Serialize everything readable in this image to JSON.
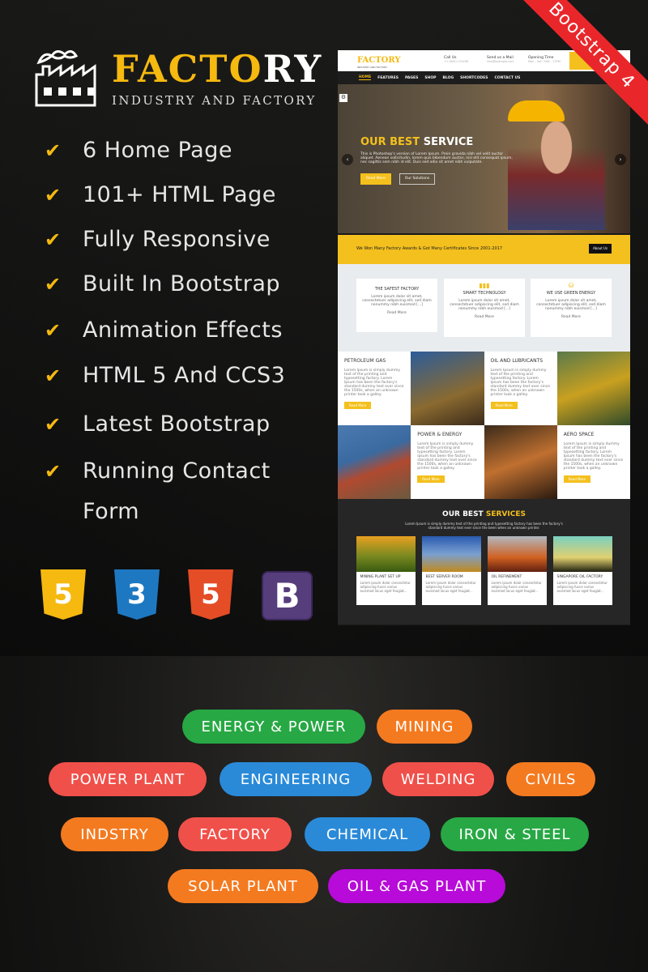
{
  "logo": {
    "title_a": "FACTO",
    "title_b": "RY",
    "subtitle": "INDUSTRY AND FACTORY"
  },
  "ribbon": "Bootstrap 4",
  "features": [
    "6 Home Page",
    "101+ HTML Page",
    "Fully Responsive",
    "Built In Bootstrap",
    "Animation Effects",
    "HTML 5 And CCS3",
    "Latest Bootstrap",
    "Running Contact Form"
  ],
  "tech_icons": [
    {
      "name": "html5-icon",
      "glyph": "5",
      "color": "#f5b90f"
    },
    {
      "name": "css3-icon",
      "glyph": "3",
      "color": "#1d78c1"
    },
    {
      "name": "html5-icon",
      "glyph": "5",
      "color": "#e44d26"
    },
    {
      "name": "bootstrap-icon",
      "glyph": "B",
      "color": "#563d7c"
    }
  ],
  "preview": {
    "logo": "FACTORY",
    "logo_sub": "INDUSTRY AND FACTORY",
    "contacts": [
      {
        "label": "Call Us",
        "value": "+1 (800) 123456"
      },
      {
        "label": "Send us a Mail",
        "value": "info@example.com"
      },
      {
        "label": "Opening Time",
        "value": "Mon - Sat: 7AM - 17PM"
      }
    ],
    "nav": [
      "HOME",
      "FEATURES",
      "PAGES",
      "SHOP",
      "BLOG",
      "SHORTCODES",
      "CONTACT US"
    ],
    "hero": {
      "title_a": "OUR BEST",
      "title_b": "SERVICE",
      "text": "This is Photoshop's version of Lorem Ipsum. Proin gravida nibh vel velit auctor aliquet. Aenean sollicitudin, lorem quis bibendum auctor, nisi elit consequat ipsum, nec sagittis sem nibh id elit. Duis sed odio sit amet nibh vulputate.",
      "btn1": "Read More",
      "btn2": "Our Solutions"
    },
    "band": {
      "text": "We Won Many Factory Awards & Got Many Certificates Since 2001-2017",
      "button": "About Us"
    },
    "cards": [
      {
        "title": "THE SAFEST FACTORY",
        "text": "Lorem ipsum dolor sit amet, consectetuer adipiscing elit, sed diam nonummy nibh euismod [...]",
        "link": "Read More"
      },
      {
        "title": "SMART TECHNOLOGY",
        "text": "Lorem ipsum dolor sit amet, consectetuer adipiscing elit, sed diam nonummy nibh euismod [...]",
        "link": "Read More"
      },
      {
        "title": "WE USE GREEN ENERGY",
        "text": "Lorem ipsum dolor sit amet, consectetuer adipiscing elit, sed diam nonummy nibh euismod [...]",
        "link": "Read More"
      }
    ],
    "grid": [
      {
        "title": "PETROLEUM GAS"
      },
      {
        "title": "OIL AND LUBRICANTS"
      },
      {
        "title": "POWER & ENERGY"
      },
      {
        "title": "AERO SPACE"
      }
    ],
    "grid_text": "Lorem Ipsum is simply dummy text of the printing and typesetting factory. Lorem Ipsum has been the factory's standard dummy text ever since the 1500s, when an unknown printer took a galley.",
    "grid_btn": "Read More",
    "services": {
      "title_a": "OUR BEST",
      "title_b": "SERVICES",
      "text": "Lorem Ipsum is simply dummy text of the printing and typesetting factory has been the factory's standard dummy text ever since the been when an unknown printer.",
      "items": [
        {
          "title": "MINING PLANT SET UP"
        },
        {
          "title": "BEST SERVER ROOM"
        },
        {
          "title": "OIL REFINEMENT"
        },
        {
          "title": "SINGAPORE OIL FACTORY"
        }
      ],
      "item_text": "Lorem ipsum dolor consectetur adipiscing fusce varius euismod lacus eget feugiat..."
    }
  },
  "tags": [
    {
      "label": "ENERGY & POWER",
      "color": "#27a844"
    },
    {
      "label": "MINING",
      "color": "#f47a20"
    },
    {
      "label": "POWER PLANT",
      "color": "#f0504a"
    },
    {
      "label": "ENGINEERING",
      "color": "#2a8ad8"
    },
    {
      "label": "WELDING",
      "color": "#f0504a"
    },
    {
      "label": "CIVILS",
      "color": "#f47a20"
    },
    {
      "label": "INDSTRY",
      "color": "#f47a20"
    },
    {
      "label": "FACTORY",
      "color": "#f0504a"
    },
    {
      "label": "CHEMICAL",
      "color": "#2a8ad8"
    },
    {
      "label": "IRON & STEEL",
      "color": "#27a844"
    },
    {
      "label": "SOLAR PLANT",
      "color": "#f47a20"
    },
    {
      "label": "OIL & GAS PLANT",
      "color": "#b80ad8"
    }
  ]
}
